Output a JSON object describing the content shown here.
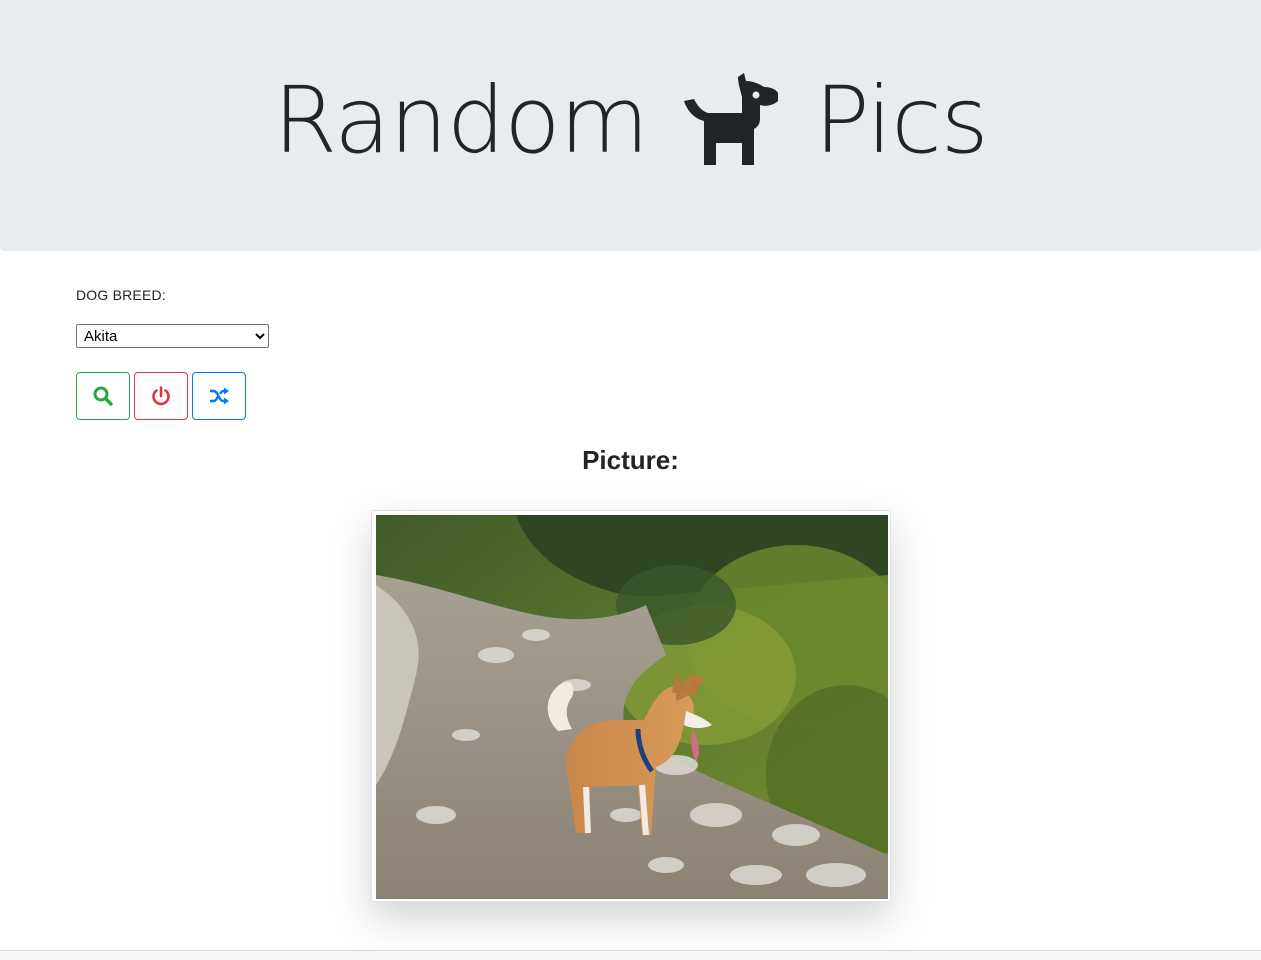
{
  "header": {
    "title_left": "Random",
    "title_icon": "dog-icon",
    "title_right": "Pics"
  },
  "form": {
    "breed_label": "DOG BREED:",
    "breed_selected": "Akita"
  },
  "buttons": {
    "search": {
      "icon": "search-icon",
      "color": "#28a745"
    },
    "reset": {
      "icon": "power-icon",
      "color": "#dc3545"
    },
    "random": {
      "icon": "shuffle-icon",
      "color": "#007bff"
    }
  },
  "picture": {
    "heading": "Picture:",
    "image_subject": "akita-dog-photo"
  },
  "colors": {
    "jumbotron_bg": "#e9ecef",
    "text": "#212529"
  }
}
